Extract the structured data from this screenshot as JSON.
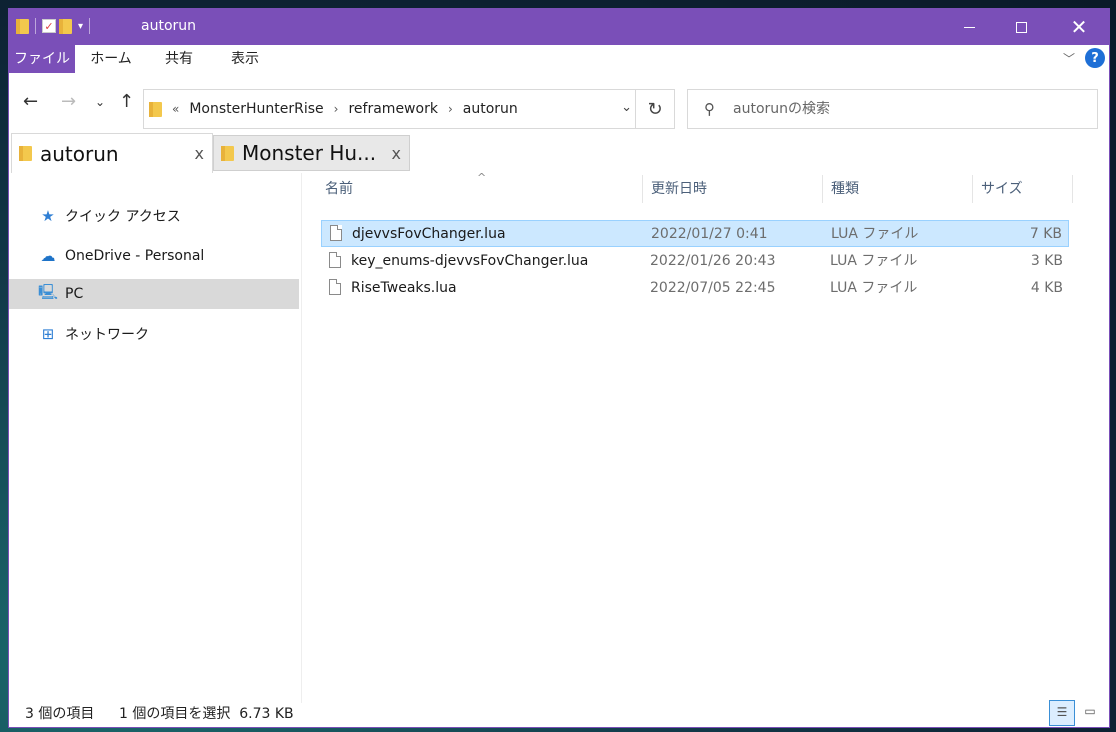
{
  "window": {
    "title": "autorun",
    "accent": "#7a4fb8"
  },
  "ribbon": {
    "tabs": [
      "ファイル",
      "ホーム",
      "共有",
      "表示"
    ],
    "help_label": "?"
  },
  "nav": {
    "breadcrumb": [
      "MonsterHunterRise",
      "reframework",
      "autorun"
    ],
    "breadcrumb_prefix": "«",
    "search_placeholder": "autorunの検索"
  },
  "tabs": [
    {
      "label": "autorun",
      "close": "x"
    },
    {
      "label": "Monster Hu...",
      "close": "x"
    }
  ],
  "sidebar": {
    "items": [
      {
        "label": "クイック アクセス",
        "icon": "star-icon"
      },
      {
        "label": "OneDrive - Personal",
        "icon": "cloud-icon"
      },
      {
        "label": "PC",
        "icon": "pc-icon"
      },
      {
        "label": "ネットワーク",
        "icon": "network-icon"
      }
    ],
    "selected": "PC"
  },
  "columns": [
    "名前",
    "更新日時",
    "種類",
    "サイズ"
  ],
  "files": [
    {
      "name": "djevvsFovChanger.lua",
      "modified": "2022/01/27 0:41",
      "type": "LUA ファイル",
      "size": "7 KB",
      "selected": true
    },
    {
      "name": "key_enums-djevvsFovChanger.lua",
      "modified": "2022/01/26 20:43",
      "type": "LUA ファイル",
      "size": "3 KB",
      "selected": false
    },
    {
      "name": "RiseTweaks.lua",
      "modified": "2022/07/05 22:45",
      "type": "LUA ファイル",
      "size": "4 KB",
      "selected": false
    }
  ],
  "status": {
    "count": "3 個の項目",
    "selection": "1 個の項目を選択  6.73 KB"
  }
}
